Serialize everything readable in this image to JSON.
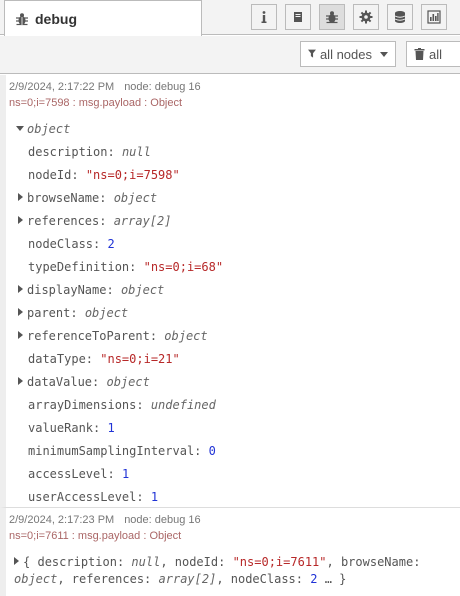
{
  "tab": {
    "title": "debug",
    "icon": "bug-icon"
  },
  "header_buttons": [
    {
      "name": "info-icon"
    },
    {
      "name": "book-icon"
    },
    {
      "name": "bug-icon"
    },
    {
      "name": "gear-icon"
    },
    {
      "name": "database-icon"
    },
    {
      "name": "chart-icon"
    }
  ],
  "toolbar": {
    "filter_label": "all nodes",
    "clear_label": "all"
  },
  "messages": [
    {
      "timestamp": "2/9/2024, 2:17:22 PM",
      "node": "node: debug 16",
      "topic": "ns=0;i=7598 : msg.payload : Object",
      "root_label": "object",
      "rows": [
        {
          "key": "description",
          "value": "null",
          "kind": "nul",
          "expandable": false
        },
        {
          "key": "nodeId",
          "value": "\"ns=0;i=7598\"",
          "kind": "str",
          "expandable": false
        },
        {
          "key": "browseName",
          "value": "object",
          "kind": "type",
          "expandable": true
        },
        {
          "key": "references",
          "value": "array[2]",
          "kind": "type",
          "expandable": true
        },
        {
          "key": "nodeClass",
          "value": "2",
          "kind": "num",
          "expandable": false
        },
        {
          "key": "typeDefinition",
          "value": "\"ns=0;i=68\"",
          "kind": "str",
          "expandable": false
        },
        {
          "key": "displayName",
          "value": "object",
          "kind": "type",
          "expandable": true
        },
        {
          "key": "parent",
          "value": "object",
          "kind": "type",
          "expandable": true
        },
        {
          "key": "referenceToParent",
          "value": "object",
          "kind": "type",
          "expandable": true
        },
        {
          "key": "dataType",
          "value": "\"ns=0;i=21\"",
          "kind": "str",
          "expandable": false
        },
        {
          "key": "dataValue",
          "value": "object",
          "kind": "type",
          "expandable": true
        },
        {
          "key": "arrayDimensions",
          "value": "undefined",
          "kind": "type",
          "expandable": false
        },
        {
          "key": "valueRank",
          "value": "1",
          "kind": "num",
          "expandable": false
        },
        {
          "key": "minimumSamplingInterval",
          "value": "0",
          "kind": "num",
          "expandable": false
        },
        {
          "key": "accessLevel",
          "value": "1",
          "kind": "num",
          "expandable": false
        },
        {
          "key": "userAccessLevel",
          "value": "1",
          "kind": "num",
          "expandable": false
        }
      ]
    },
    {
      "timestamp": "2/9/2024, 2:17:23 PM",
      "node": "node: debug 16",
      "topic": "ns=0;i=7611 : msg.payload : Object",
      "summary": {
        "open": "{",
        "k1": "description:",
        "v1": "null",
        "k2": ", nodeId:",
        "v2": "\"ns=0;i=7611\"",
        "k3": ", browseName:",
        "v3": "object",
        "k4": ", references:",
        "v4": "array[2]",
        "k5": ", nodeClass:",
        "v5": "2",
        "close": "… }"
      }
    }
  ]
}
